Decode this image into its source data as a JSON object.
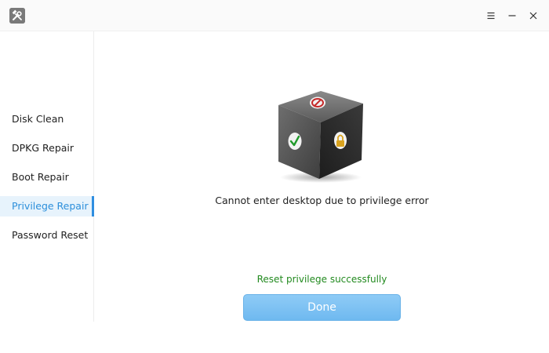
{
  "window": {
    "app_icon": "tools-icon",
    "controls": {
      "menu_icon": "hamburger-menu-icon",
      "minimize_icon": "minimize-icon",
      "close_icon": "close-icon"
    }
  },
  "sidebar": {
    "items": [
      {
        "label": "Disk Clean",
        "active": false
      },
      {
        "label": "DPKG Repair",
        "active": false
      },
      {
        "label": "Boot Repair",
        "active": false
      },
      {
        "label": "Privilege Repair",
        "active": true
      },
      {
        "label": "Password Reset",
        "active": false
      }
    ]
  },
  "main": {
    "illustration": "privilege-cube-icon",
    "message": "Cannot enter desktop due to privilege error",
    "status": "Reset privilege successfully",
    "done_label": "Done"
  },
  "colors": {
    "accent": "#2c8fdb",
    "active_bg": "#e7f3fc",
    "success_text": "#228a1f",
    "button_bg": "#7dc1f3"
  }
}
